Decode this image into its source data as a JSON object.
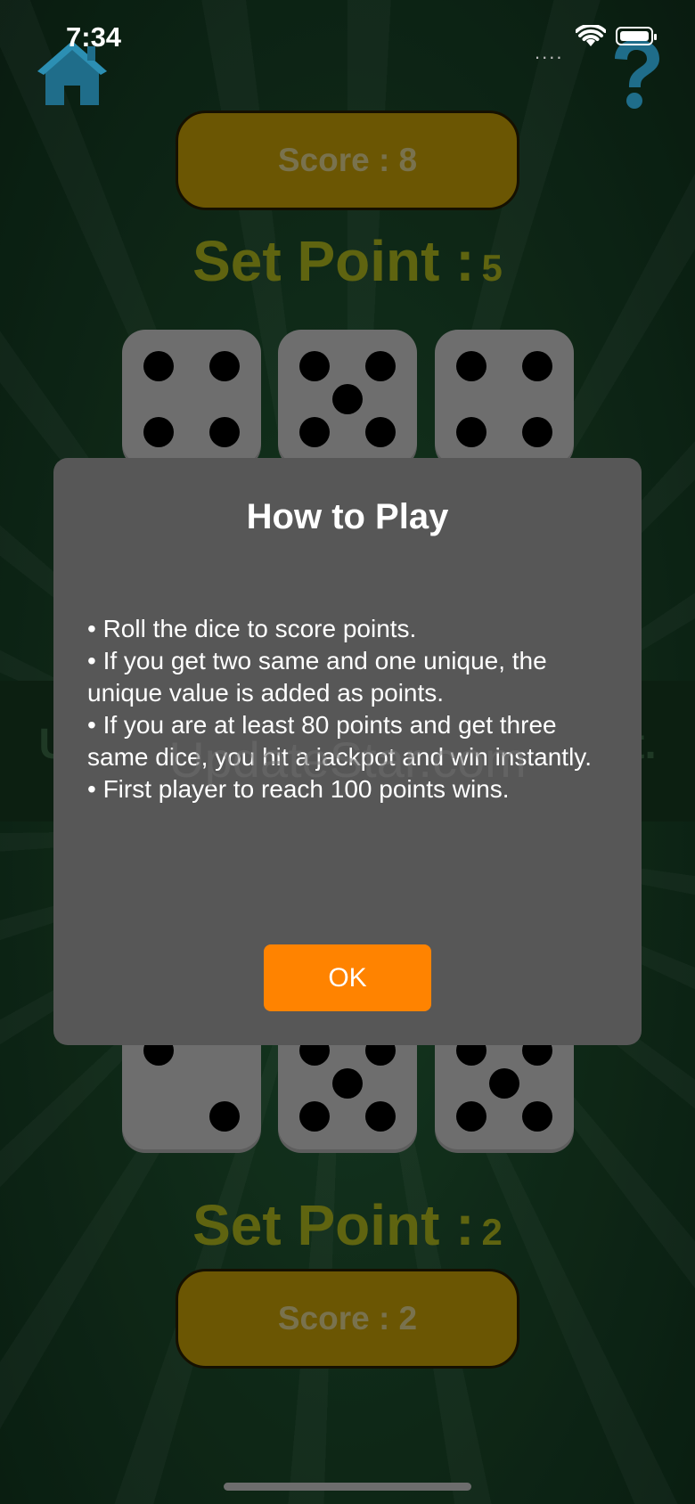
{
  "status_bar": {
    "time": "7:34",
    "signal": "....",
    "icons": [
      "wifi-icon",
      "battery-icon"
    ]
  },
  "nav": {
    "home_icon": "home-icon",
    "help_icon": "help-icon"
  },
  "top_player": {
    "score_text": "Score : 8",
    "set_point_label": "Set Point :",
    "set_point_value": "5",
    "dice": [
      4,
      5,
      4
    ]
  },
  "bottom_player": {
    "score_text": "Score : 2",
    "set_point_label": "Set Point :",
    "set_point_value": "2",
    "dice": [
      2,
      5,
      5
    ]
  },
  "banner": {
    "text_left": "U",
    "text_right": "nt."
  },
  "watermark": "UpdateStar.com",
  "dialog": {
    "title": "How to Play",
    "rules": [
      "• Roll the dice to score points.",
      "• If you get two same and one unique, the unique value is added as points.",
      "• If you are at least 80 points and get three same dice, you hit a jackpot and win instantly.",
      "• First player to reach 100 points wins."
    ],
    "ok_label": "OK"
  },
  "colors": {
    "ok_button": "#ff8300",
    "score_pill": "#8a6f05",
    "set_point_text": "#7a8015",
    "dialog_bg": "#575757"
  }
}
